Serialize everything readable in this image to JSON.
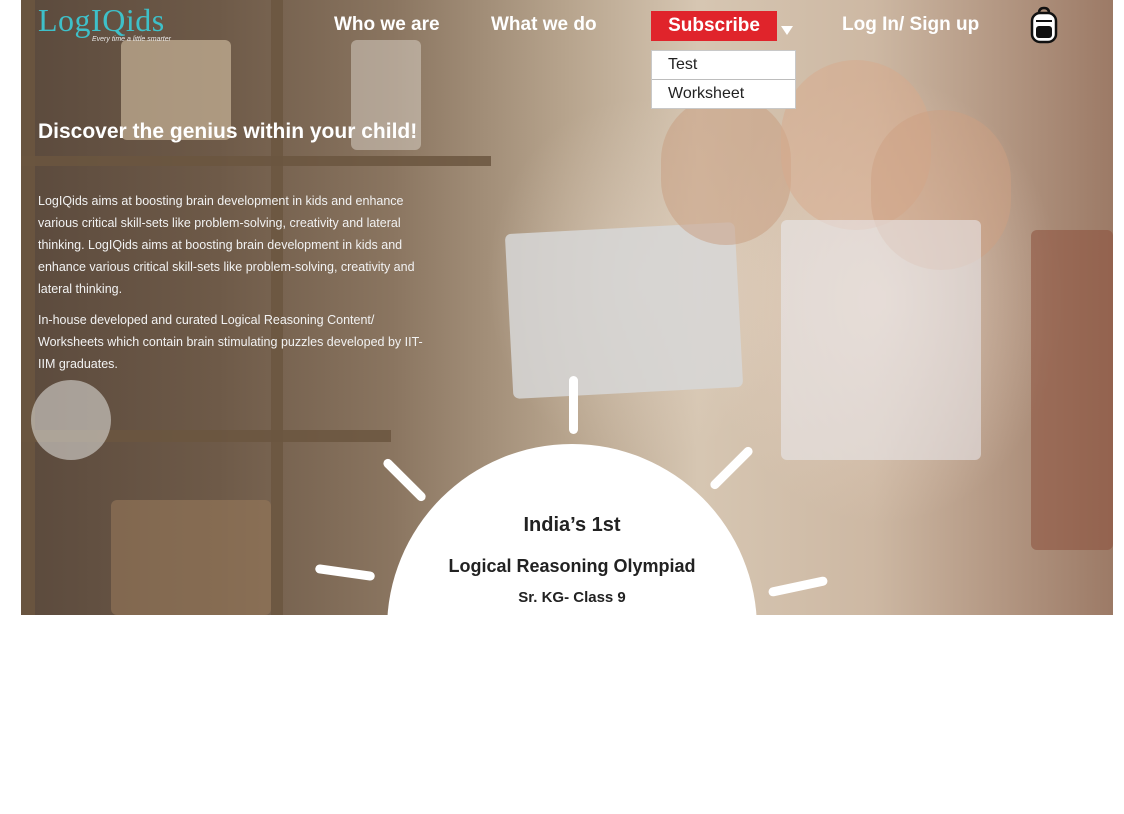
{
  "brand": {
    "logo": "LogIQids",
    "tagline": "Every time a little smarter"
  },
  "nav": {
    "who_we_are": "Who we are",
    "what_we_do": "What we do",
    "subscribe": "Subscribe",
    "login": "Log In/ Sign up",
    "subscribe_options": [
      "Test",
      "Worksheet"
    ]
  },
  "hero": {
    "headline": "Discover the genius within your child!",
    "paragraph_1": "LogIQids aims at boosting brain development in kids and enhance various critical skill-sets like problem-solving, creativity and lateral thinking. LogIQids aims at boosting brain development in kids and enhance various critical skill-sets like problem-solving, creativity and lateral thinking.",
    "paragraph_2": "In-house developed and curated Logical Reasoning Content/ Worksheets which contain brain stimulating puzzles developed by IIT-IIM graduates."
  },
  "badge": {
    "line1": "India’s 1st",
    "line2": "Logical Reasoning Olympiad",
    "line3": "Sr. KG- Class 9"
  },
  "colors": {
    "accent": "#e0242b",
    "logo": "#3ec0c9"
  },
  "icons": {
    "bag": "backpack-icon",
    "caret": "caret-down-icon"
  }
}
